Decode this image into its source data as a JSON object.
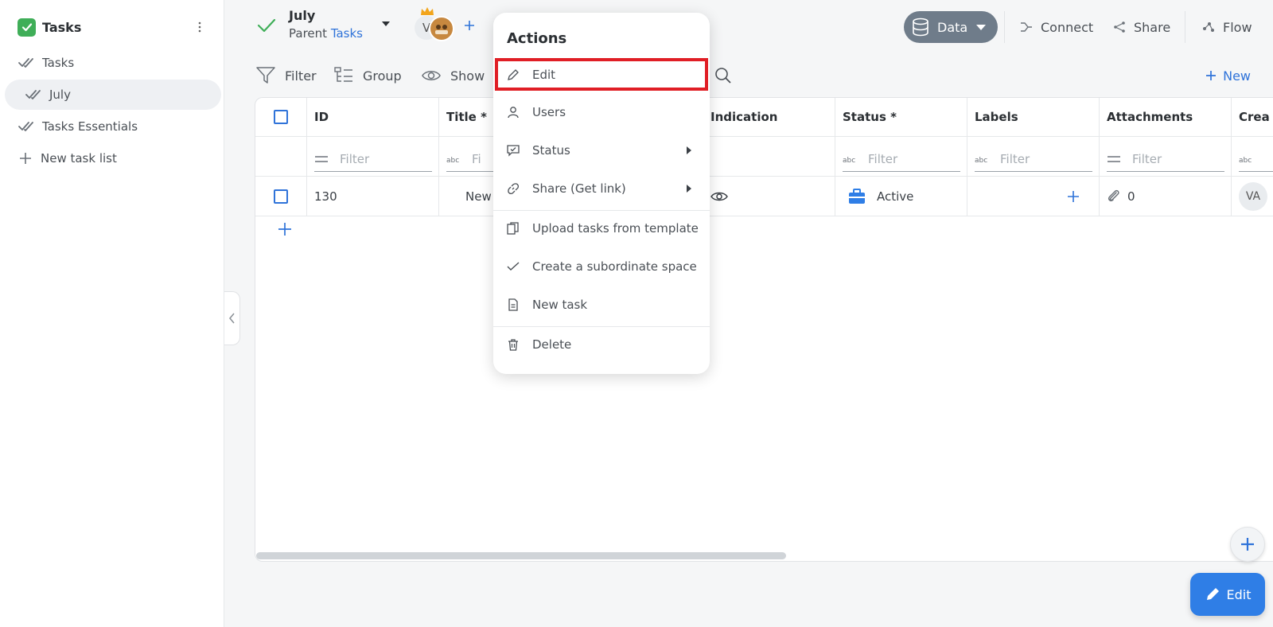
{
  "sidebar": {
    "title": "Tasks",
    "items": [
      {
        "label": "Tasks"
      },
      {
        "label": "July"
      },
      {
        "label": "Tasks Essentials"
      },
      {
        "label": "New task list"
      }
    ]
  },
  "topbar": {
    "title": "July",
    "parent_label": "Parent",
    "parent_link": "Tasks",
    "avatar_initial": "V",
    "data_label": "Data",
    "connect_label": "Connect",
    "share_label": "Share",
    "flow_label": "Flow"
  },
  "toolbar": {
    "filter": "Filter",
    "group": "Group",
    "show": "Show",
    "new": "New"
  },
  "table": {
    "columns": [
      "ID",
      "Title *",
      "Indication",
      "Status *",
      "Labels",
      "Attachments",
      "Crea"
    ],
    "filter_placeholder": "Filter",
    "filter_partial": "Fi",
    "rows": [
      {
        "id": "130",
        "title": "New",
        "status": "Active",
        "attachments": "0",
        "created": "VA"
      }
    ]
  },
  "fab": {
    "edit_label": "Edit"
  },
  "menu": {
    "title": "Actions",
    "items": [
      {
        "label": "Edit"
      },
      {
        "label": "Users"
      },
      {
        "label": "Status"
      },
      {
        "label": "Share (Get link)"
      },
      {
        "label": "Upload tasks from template"
      },
      {
        "label": "Create a subordinate space"
      },
      {
        "label": "New task"
      },
      {
        "label": "Delete"
      }
    ]
  },
  "colors": {
    "accent": "#2f73d9",
    "brand_green": "#3fae58",
    "highlight": "#e01e25",
    "data_button": "#6f7c8a"
  }
}
